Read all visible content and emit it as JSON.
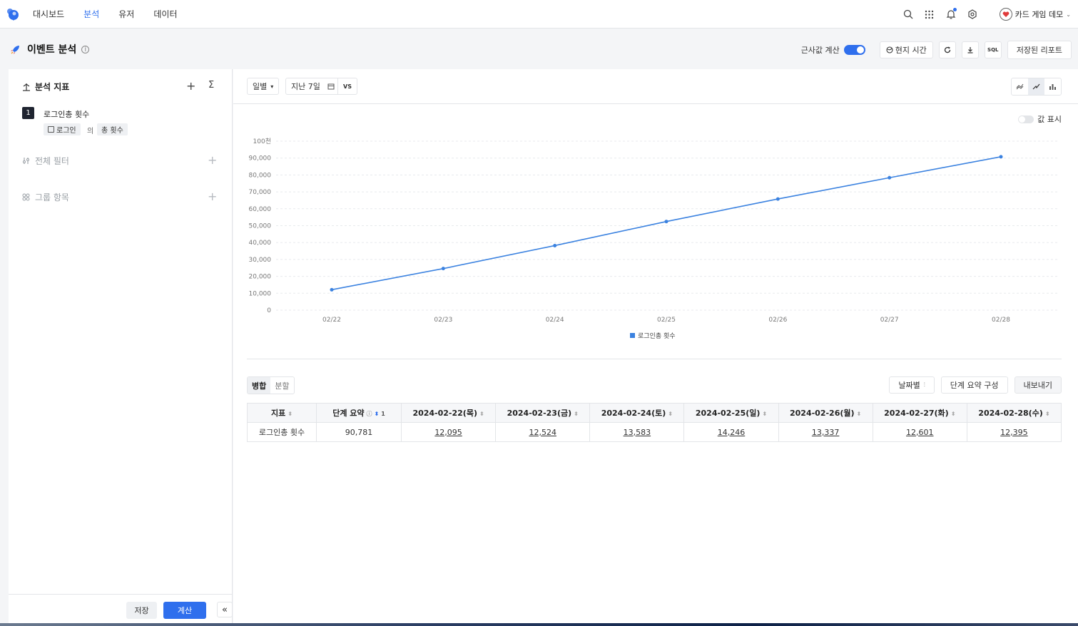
{
  "nav": {
    "items": [
      "대시보드",
      "분석",
      "유저",
      "데이터"
    ],
    "active_index": 1,
    "account_name": "카드 게임 데모",
    "accent": "#2f6fed"
  },
  "titlebar": {
    "title": "이벤트 분석",
    "approx_label": "근사값 계산",
    "approx_enabled": true,
    "local_time_label": "현지 시간",
    "sql_label": "SQL",
    "saved_report_label": "저장된 리포트"
  },
  "left": {
    "metrics_title": "분석 지표",
    "sum_symbol": "Σ",
    "metric": {
      "index": "1",
      "name": "로그인총 횟수",
      "event_chip": "로그인",
      "of_text": "의",
      "agg_chip": "총 횟수"
    },
    "filter_title": "전체 필터",
    "group_title": "그룹 항목",
    "save_label": "저장",
    "calc_label": "계산",
    "collapse_symbol": "«"
  },
  "toolbar": {
    "period_select": "일별",
    "range_select": "지난 7일",
    "vs_label": "VS",
    "value_toggle_label": "값 표시"
  },
  "chart_data": {
    "type": "line",
    "categories": [
      "02/22",
      "02/23",
      "02/24",
      "02/25",
      "02/26",
      "02/27",
      "02/28"
    ],
    "series": [
      {
        "name": "로그인총 횟수",
        "values": [
          12095,
          24619,
          38202,
          52448,
          65785,
          78386,
          90781
        ],
        "color": "#3b82e0"
      }
    ],
    "y_ticks": [
      "0",
      "10,000",
      "20,000",
      "30,000",
      "40,000",
      "50,000",
      "60,000",
      "70,000",
      "80,000",
      "90,000",
      "100천"
    ],
    "ylim": [
      0,
      100000
    ],
    "grid": true,
    "legend_position": "bottom-center"
  },
  "table": {
    "seg_merge": "병합",
    "seg_split": "분할",
    "by_date_label": "날짜별",
    "stage_summary_config_label": "단계 요약 구성",
    "export_label": "내보내기",
    "headers": [
      "지표",
      "단계 요약",
      "2024-02-22(목)",
      "2024-02-23(금)",
      "2024-02-24(토)",
      "2024-02-25(일)",
      "2024-02-26(월)",
      "2024-02-27(화)",
      "2024-02-28(수)"
    ],
    "sort_index": "1",
    "rows": [
      [
        "로그인총 횟수",
        "90,781",
        "12,095",
        "12,524",
        "13,583",
        "14,246",
        "13,337",
        "12,601",
        "12,395"
      ]
    ]
  }
}
